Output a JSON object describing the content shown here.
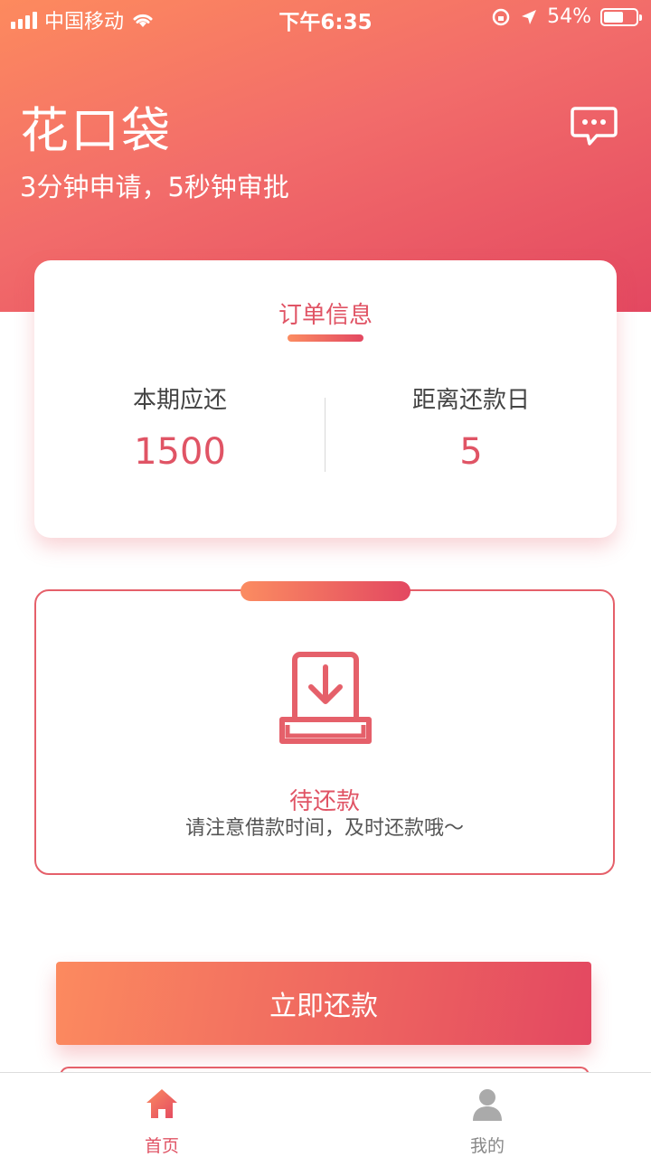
{
  "status_bar": {
    "carrier": "中国移动",
    "time": "下午6:35",
    "battery": "54%"
  },
  "header": {
    "title": "花口袋",
    "subtitle": "3分钟申请，5秒钟审批",
    "message_icon": "chat-bubble-icon"
  },
  "order_card": {
    "title": "订单信息",
    "left": {
      "label": "本期应还",
      "value": "1500"
    },
    "right": {
      "label": "距离还款日",
      "value": "5"
    }
  },
  "status_card": {
    "icon": "download-tray-icon",
    "title": "待还款",
    "description": "请注意借款时间，及时还款哦～"
  },
  "cta": {
    "label": "立即还款"
  },
  "tab_bar": {
    "items": [
      {
        "label": "首页",
        "icon": "home-icon",
        "active": true
      },
      {
        "label": "我的",
        "icon": "user-icon",
        "active": false
      }
    ]
  },
  "colors": {
    "accent": "#e34861",
    "gradient_start": "#fd8a5e"
  }
}
